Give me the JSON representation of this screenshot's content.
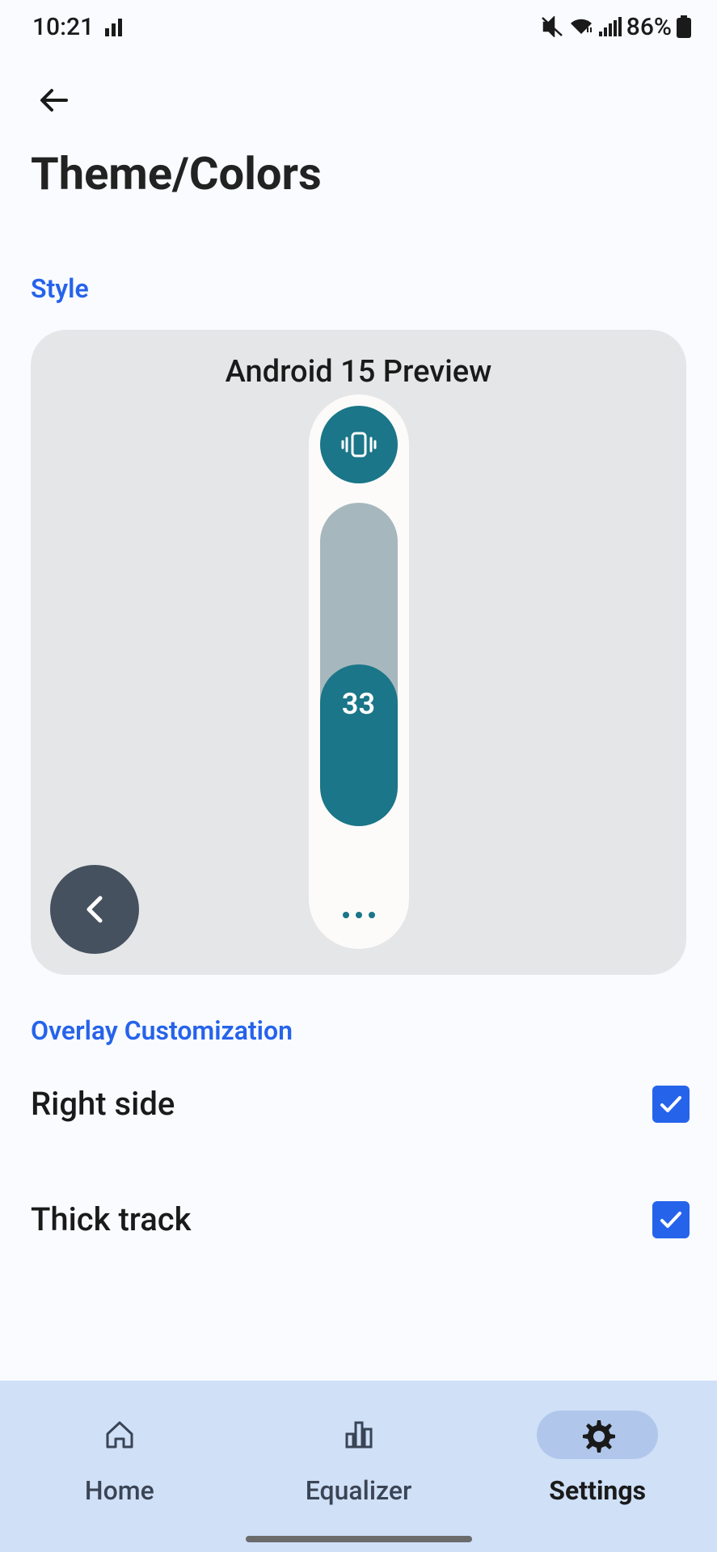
{
  "status": {
    "time": "10:21",
    "battery": "86%"
  },
  "header": {
    "title": "Theme/Colors"
  },
  "sections": {
    "style": "Style",
    "overlay": "Overlay Customization"
  },
  "preview": {
    "title": "Android 15 Preview",
    "slider_value": "33"
  },
  "settings": {
    "right_side": {
      "label": "Right side",
      "checked": true
    },
    "thick_track": {
      "label": "Thick track",
      "checked": true
    }
  },
  "nav": {
    "home": "Home",
    "equalizer": "Equalizer",
    "settings": "Settings",
    "active": "settings"
  }
}
